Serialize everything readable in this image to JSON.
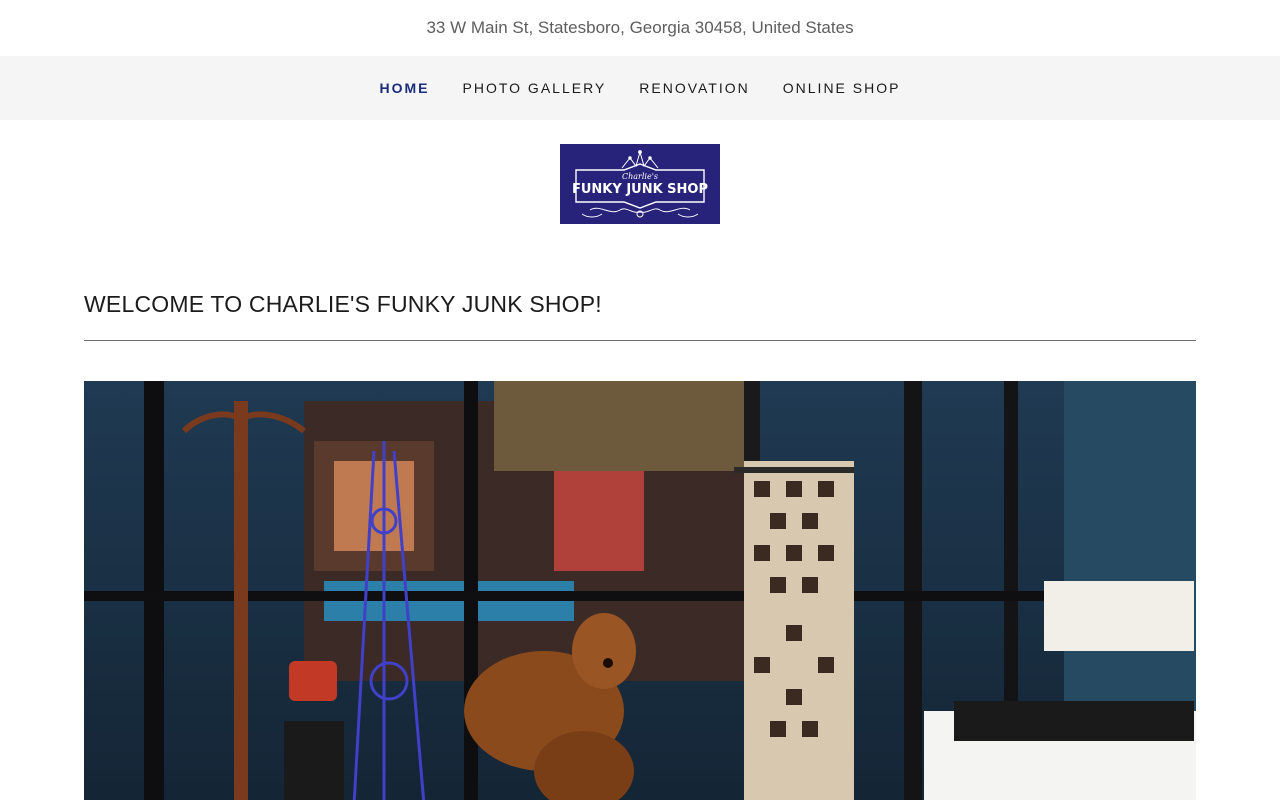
{
  "header": {
    "address": "33 W Main St, Statesboro, Georgia 30458, United States"
  },
  "nav": {
    "items": [
      {
        "label": "HOME",
        "active": true
      },
      {
        "label": "PHOTO GALLERY",
        "active": false
      },
      {
        "label": "RENOVATION",
        "active": false
      },
      {
        "label": "ONLINE SHOP",
        "active": false
      }
    ]
  },
  "logo": {
    "script_text": "Charlie's",
    "main_text": "FUNKY JUNK SHOP",
    "background": "#27237a"
  },
  "main": {
    "heading": "WELCOME TO CHARLIE'S FUNKY JUNK SHOP!"
  },
  "colors": {
    "nav_active": "#1a2d7a",
    "nav_bg": "#f5f5f5"
  }
}
